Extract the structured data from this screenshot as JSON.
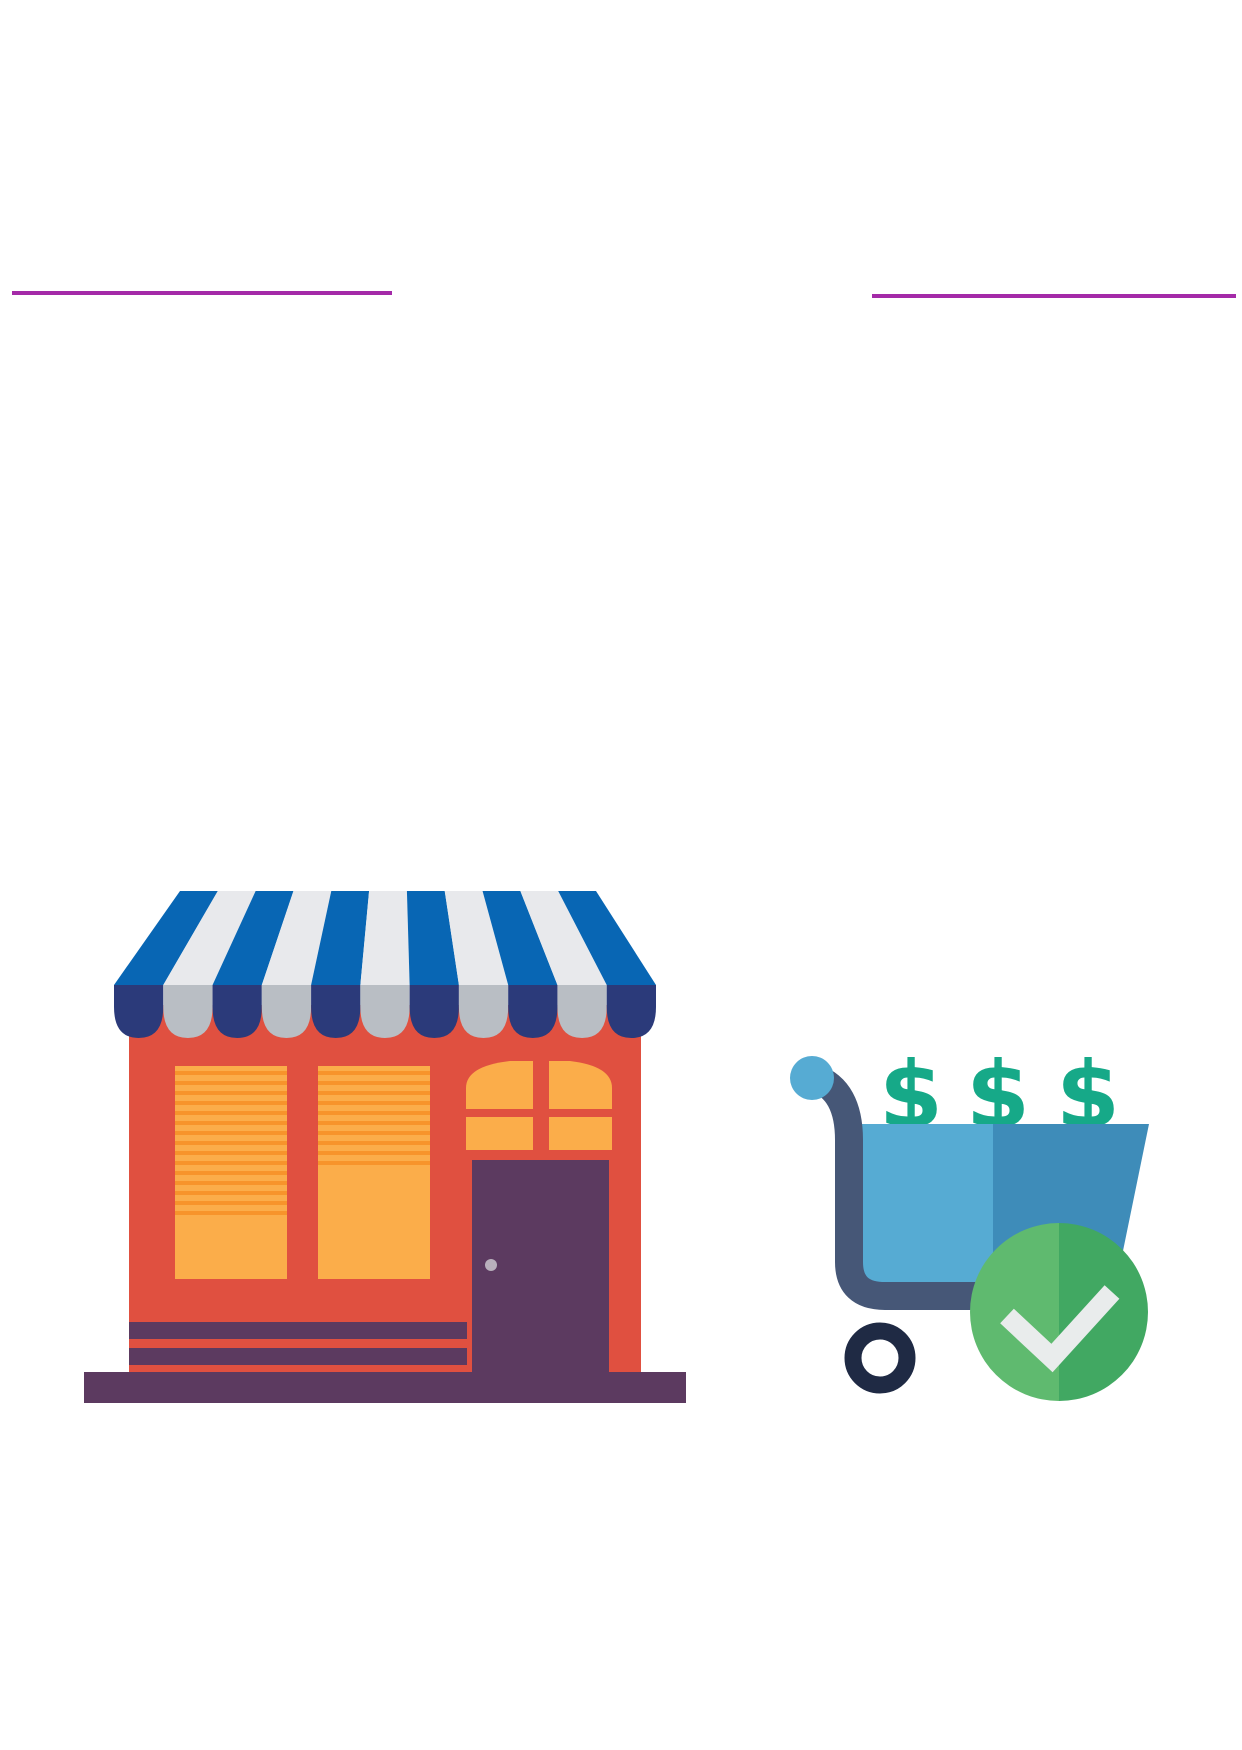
{
  "colors": {
    "background": "#ffffff",
    "divider": "#a42aa8",
    "awning_blue": "#0866b4",
    "awning_white": "#e8e9ec",
    "awning_scallop_dark": "#2b3a7a",
    "awning_scallop_light": "#b9bec4",
    "shop_wall": "#e05040",
    "shop_window": "#fbad4a",
    "window_slat": "#f7942b",
    "door": "#5c3a60",
    "door_knob": "#b9b0bc",
    "base": "#5c3a60",
    "cart_frame": "#465777",
    "cart_basket_light": "#56abd3",
    "cart_basket_dark": "#3e8cb9",
    "cart_handle_ball": "#56abd3",
    "cart_wheel": "#1f2a44",
    "dollar": "#16a988",
    "check_circle_light": "#5fba6f",
    "check_circle_dark": "#41a862",
    "checkmark": "#e9ecec"
  },
  "icons": {
    "shop": "storefront-icon",
    "cart": "shopping-cart-icon",
    "check": "checkmark-icon"
  },
  "cart": {
    "dollar_symbols": [
      "$",
      "$",
      "$"
    ]
  }
}
